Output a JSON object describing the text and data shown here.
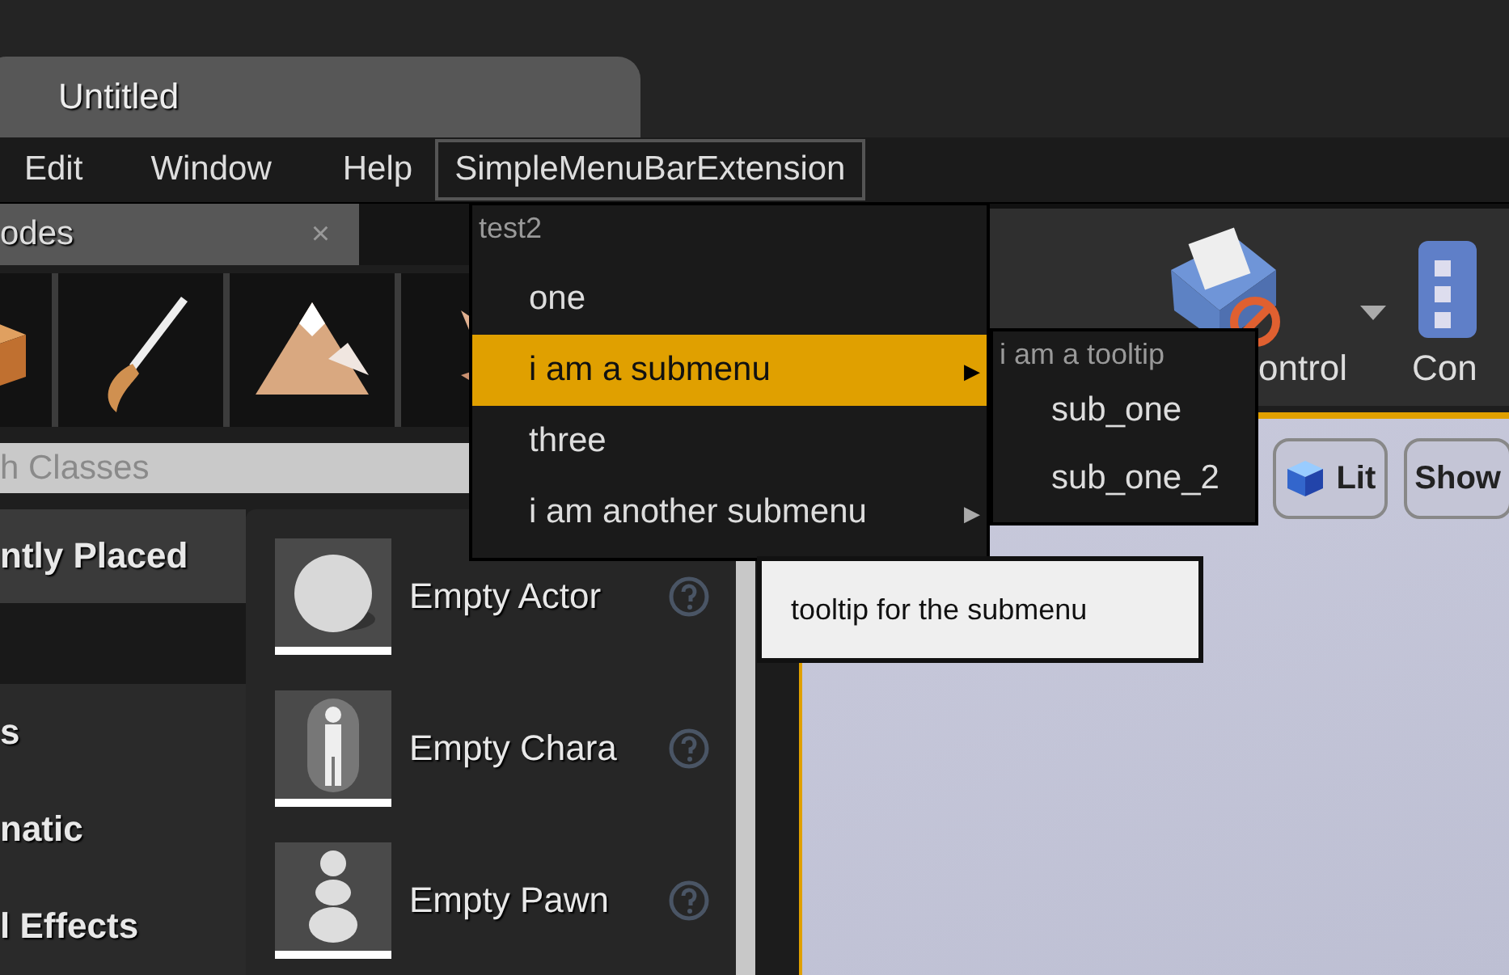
{
  "document_tab": {
    "title": "Untitled"
  },
  "menu_bar": [
    {
      "label": "Edit",
      "open": false
    },
    {
      "label": "Window",
      "open": false
    },
    {
      "label": "Help",
      "open": false
    },
    {
      "label": "SimpleMenuBarExtension",
      "open": true
    }
  ],
  "modes_panel": {
    "tab": {
      "title": "odes",
      "close": "×"
    },
    "search": {
      "placeholder": "h Classes"
    },
    "categories": [
      {
        "label": "ntly Placed",
        "selected": true
      },
      {
        "label": "s",
        "selected": false
      },
      {
        "label": "natic",
        "selected": false
      },
      {
        "label": "l Effects",
        "selected": false
      }
    ],
    "items": [
      {
        "label": "Empty Actor",
        "kind": "sphere"
      },
      {
        "label": "Empty Chara",
        "kind": "figure"
      },
      {
        "label": "Empty Pawn",
        "kind": "pawn"
      }
    ]
  },
  "toolbar": [
    {
      "label": "ontrol",
      "dropdown": true
    },
    {
      "label": "Con",
      "dropdown": false
    }
  ],
  "viewport": {
    "buttons": [
      {
        "label": "Lit",
        "kind": "lit"
      },
      {
        "label": "Show",
        "kind": "plain"
      }
    ]
  },
  "dropdown_menu": {
    "header": "test2",
    "items": [
      {
        "label": "one",
        "selected": false
      },
      {
        "label": "i am a submenu",
        "arrow": "▶",
        "selected": true
      },
      {
        "label": "three",
        "selected": false
      },
      {
        "label": "i am another submenu",
        "arrow": "▶",
        "selected": false
      }
    ]
  },
  "submenu": {
    "header": "i am a tooltip",
    "items": [
      {
        "label": "sub_one"
      },
      {
        "label": "sub_one_2"
      }
    ]
  },
  "tooltip": {
    "text": "tooltip for the submenu"
  }
}
